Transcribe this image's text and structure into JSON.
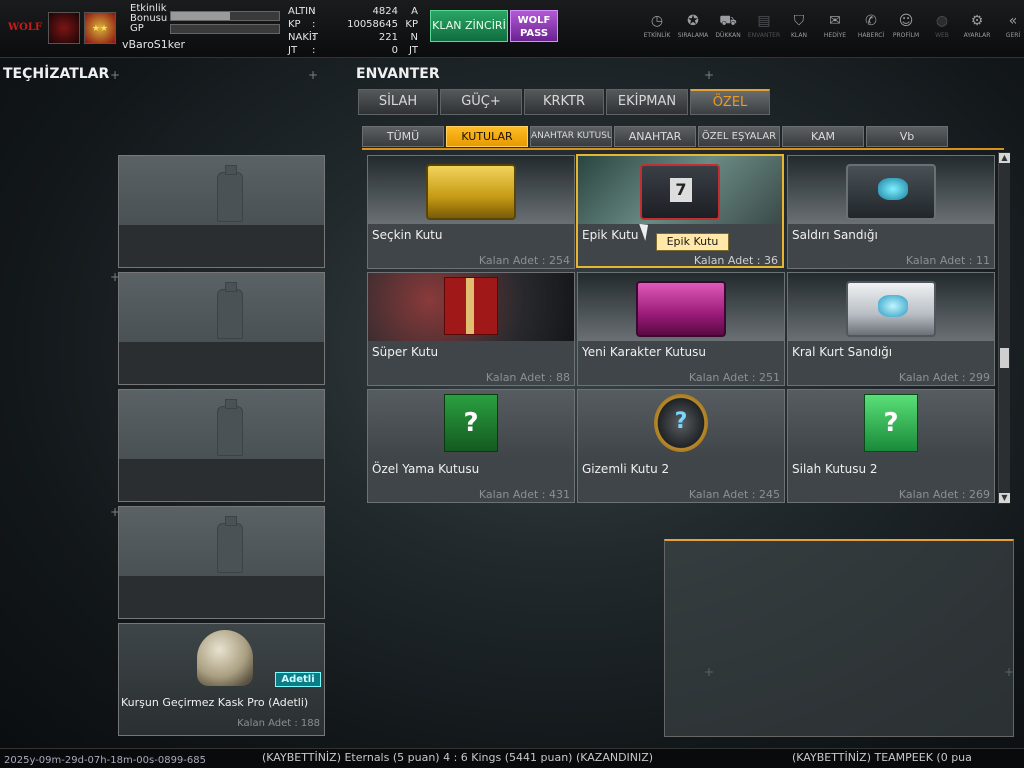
{
  "header": {
    "username": "vBaroS1ker",
    "logo_text": "WOLF",
    "event_bonus_label": "Etkinlik Bonusu",
    "event_bonus_progress": 0.55,
    "gp_label": "GP",
    "gp_progress": 0.0,
    "currencies": [
      {
        "name": "ALTIN",
        "value": "4824",
        "unit": "A"
      },
      {
        "name": "KP",
        "value": "10058645",
        "unit": "KP"
      },
      {
        "name": "NAKİT",
        "value": "221",
        "unit": "N"
      },
      {
        "name": "JT",
        "value": "0",
        "unit": "JT"
      }
    ],
    "klan_button": "KLAN ZİNCİRİ",
    "wolf_pass_line1": "WOLF",
    "wolf_pass_line2": "PASS",
    "nav": [
      {
        "label": "ETKİNLİK",
        "icon": "stopwatch-icon",
        "glyph": "◷"
      },
      {
        "label": "SIRALAMA",
        "icon": "medal-icon",
        "glyph": "✪"
      },
      {
        "label": "DÜKKAN",
        "icon": "cart-icon",
        "glyph": "⛟"
      },
      {
        "label": "ENVANTER",
        "icon": "inventory-icon",
        "glyph": "▤"
      },
      {
        "label": "KLAN",
        "icon": "shield-icon",
        "glyph": "⛉"
      },
      {
        "label": "HEDİYE",
        "icon": "gift-icon",
        "glyph": "✉"
      },
      {
        "label": "HABERCİ",
        "icon": "megaphone-icon",
        "glyph": "✆"
      },
      {
        "label": "PROFİLM",
        "icon": "profile-icon",
        "glyph": "☺"
      },
      {
        "label": "WEB",
        "icon": "globe-icon",
        "glyph": "◍"
      },
      {
        "label": "AYARLAR",
        "icon": "gear-icon",
        "glyph": "⚙"
      },
      {
        "label": "GERİ",
        "icon": "back-icon",
        "glyph": "«"
      }
    ]
  },
  "left": {
    "title": "TEÇHİZATLAR",
    "equipped_item": {
      "name": "Kurşun Geçirmez Kask Pro (Adetli)",
      "badge": "Adetli",
      "count_text": "Kalan Adet : 188"
    }
  },
  "inventory": {
    "title": "ENVANTER",
    "main_tabs": [
      "SİLAH",
      "GÜÇ+",
      "KRKTR",
      "EKİPMAN",
      "ÖZEL"
    ],
    "active_main_tab": "ÖZEL",
    "sub_tabs": [
      "TÜMÜ",
      "KUTULAR",
      "ANAHTAR KUTUSU",
      "ANAHTAR",
      "ÖZEL EŞYALAR",
      "KAM",
      "Vb"
    ],
    "active_sub_tab": "KUTULAR",
    "items": [
      {
        "name": "Seçkin Kutu",
        "count_text": "Kalan Adet : 254",
        "kind": "gold-box"
      },
      {
        "name": "Epik Kutu",
        "count_text": "Kalan Adet : 36",
        "kind": "epic-box"
      },
      {
        "name": "Saldırı Sandığı",
        "count_text": "Kalan Adet : 11",
        "kind": "dark-chest"
      },
      {
        "name": "Süper Kutu",
        "count_text": "Kalan Adet : 88",
        "kind": "gift-box"
      },
      {
        "name": "Yeni Karakter Kutusu",
        "count_text": "Kalan Adet : 251",
        "kind": "pink-box"
      },
      {
        "name": "Kral Kurt Sandığı",
        "count_text": "Kalan Adet : 299",
        "kind": "silver-chest"
      },
      {
        "name": "Özel Yama Kutusu",
        "count_text": "Kalan Adet : 431",
        "kind": "green-gift"
      },
      {
        "name": "Gizemli Kutu 2",
        "count_text": "Kalan Adet : 245",
        "kind": "mystery-box"
      },
      {
        "name": "Silah Kutusu 2",
        "count_text": "Kalan Adet : 269",
        "kind": "green-cube"
      }
    ],
    "selected_item": "Epik Kutu",
    "tooltip": "Epik Kutu"
  },
  "ticker": {
    "timestamp": "2025y-09m-29d-07h-18m-00s-0899-685",
    "text": "(KAYBETTİNİZ) Eternals (5 puan) 4 : 6 Kings (5441 puan) (KAZANDINIZ)",
    "text_right": "(KAYBETTİNİZ) TEAMPEEK (0 pua"
  },
  "colors": {
    "accent": "#e3a23a",
    "selected_tab": "#f5a800",
    "klan_green": "#1f8a54",
    "wolf_purple": "#a24dc9",
    "badge_teal": "#0e7c86"
  }
}
